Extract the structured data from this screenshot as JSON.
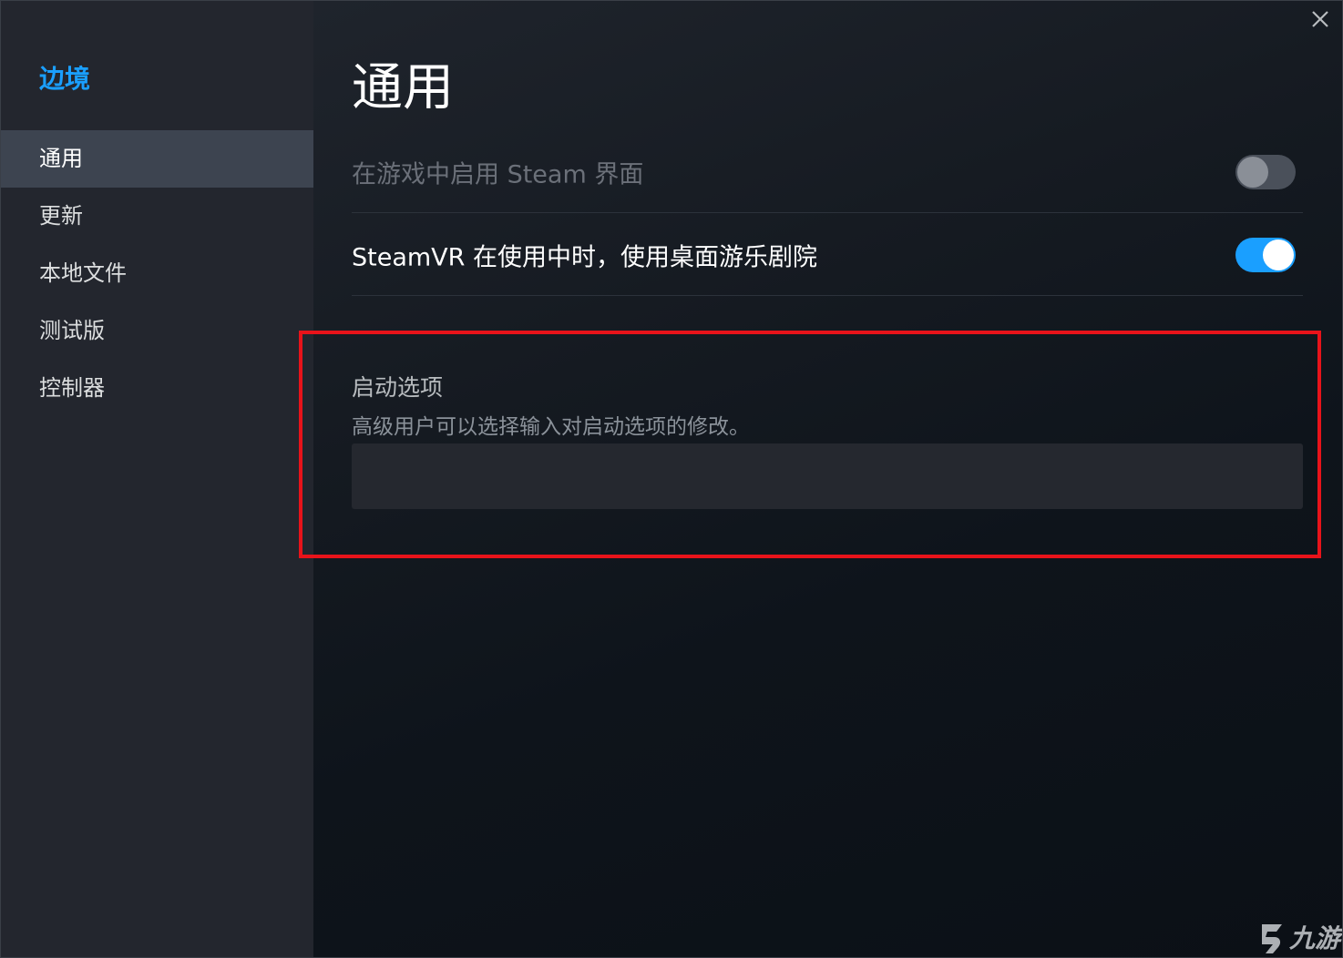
{
  "sidebar": {
    "game_title": "边境",
    "items": [
      {
        "label": "通用",
        "active": true
      },
      {
        "label": "更新",
        "active": false
      },
      {
        "label": "本地文件",
        "active": false
      },
      {
        "label": "测试版",
        "active": false
      },
      {
        "label": "控制器",
        "active": false
      }
    ]
  },
  "main": {
    "page_title": "通用",
    "settings": [
      {
        "label": "在游戏中启用 Steam 界面",
        "enabled": false,
        "disabled": true
      },
      {
        "label": "SteamVR 在使用中时，使用桌面游乐剧院",
        "enabled": true,
        "disabled": false
      }
    ],
    "launch_options": {
      "title": "启动选项",
      "description": "高级用户可以选择输入对启动选项的修改。",
      "value": ""
    }
  },
  "window": {
    "close_icon": "close-icon"
  },
  "watermark": {
    "text": "九游"
  },
  "colors": {
    "accent": "#1a9fff",
    "highlight": "#e8131a",
    "sidebar_bg": "#23262e",
    "active_item_bg": "#3d4450"
  }
}
